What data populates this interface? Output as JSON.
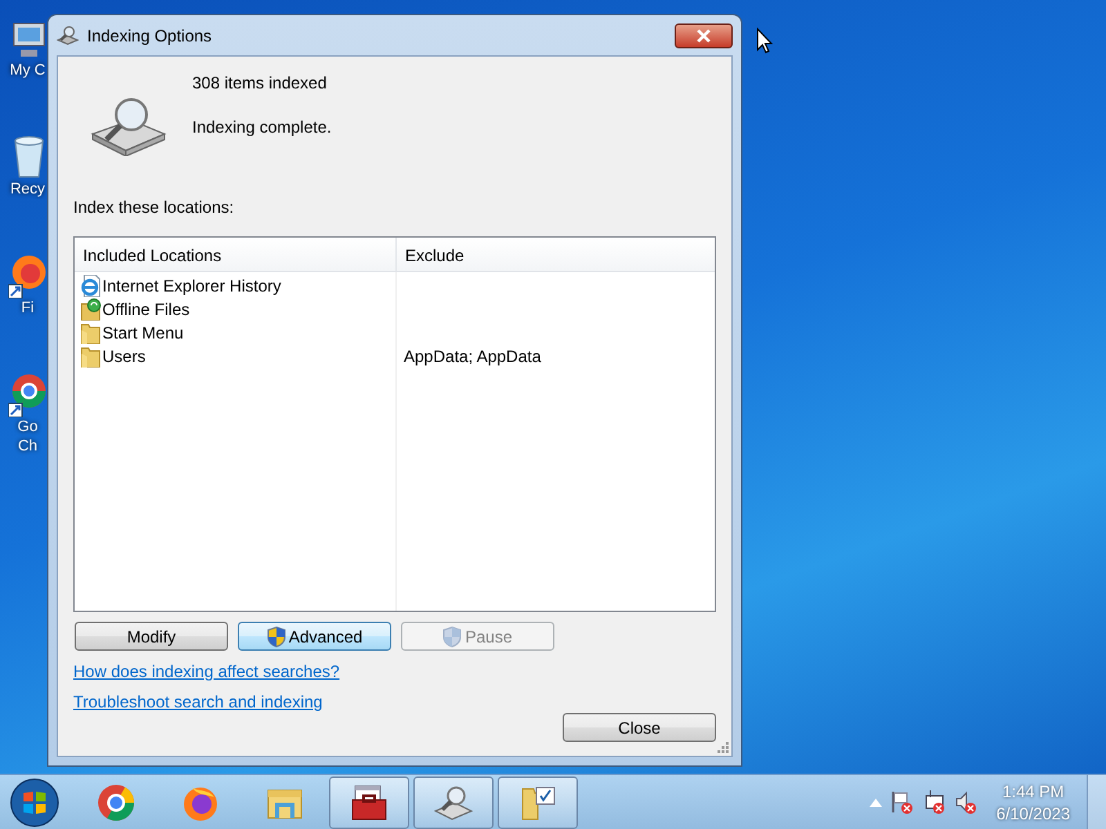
{
  "desktop_icons": [
    {
      "kind": "computer",
      "label": "My C"
    },
    {
      "kind": "recycle",
      "label": "Recy"
    },
    {
      "kind": "firefox",
      "label": "Fi"
    },
    {
      "kind": "chrome",
      "label": "Go Ch"
    }
  ],
  "window": {
    "title": "Indexing Options",
    "items_indexed": "308 items indexed",
    "status": "Indexing complete.",
    "locations_label": "Index these locations:",
    "table": {
      "columns": [
        "Included Locations",
        "Exclude"
      ],
      "rows": [
        {
          "kind": "ie",
          "location": "Internet Explorer History"
        },
        {
          "kind": "offline",
          "location": "Offline Files"
        },
        {
          "kind": "folder",
          "location": "Start Menu"
        },
        {
          "kind": "folder",
          "location": "Users",
          "exclude": "AppData; AppData"
        }
      ]
    },
    "buttons": [
      {
        "label": "Modify",
        "shield": false,
        "default": false,
        "disabled": false
      },
      {
        "label": "Advanced",
        "shield": true,
        "default": true,
        "disabled": false
      },
      {
        "label": "Pause",
        "shield": true,
        "default": false,
        "disabled": true
      }
    ],
    "links": [
      "How does indexing affect searches?",
      "Troubleshoot search and indexing"
    ],
    "close_button": "Close"
  },
  "taskbar": {
    "items": [
      {
        "kind": "chrome",
        "running": false
      },
      {
        "kind": "firefox",
        "running": false
      },
      {
        "kind": "explorer",
        "running": false
      },
      {
        "kind": "toolbox",
        "running": true
      },
      {
        "kind": "indexing",
        "running": true
      },
      {
        "kind": "folder-check",
        "running": true
      }
    ],
    "tray": [
      {
        "kind": "flag"
      },
      {
        "kind": "network"
      },
      {
        "kind": "speaker"
      }
    ],
    "time": "1:44 PM",
    "date": "6/10/2023"
  }
}
